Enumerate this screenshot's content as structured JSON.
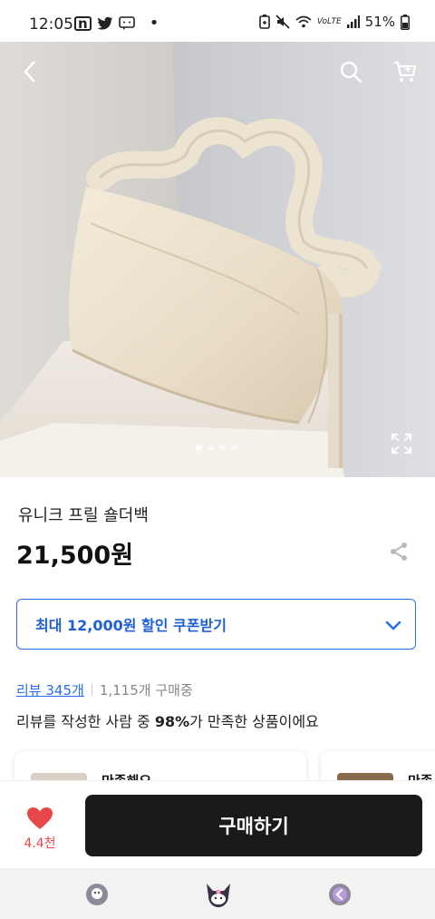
{
  "status_bar": {
    "time": "12:05",
    "battery": "51%",
    "left_icons": [
      "n-app-icon",
      "twitter-icon",
      "chat-icon",
      "dot-icon"
    ],
    "right_icons": [
      "battery-saver-icon",
      "mute-icon",
      "wifi-icon",
      "volte-icon",
      "signal-icon",
      "battery-icon"
    ],
    "volte_label": "VoLTE"
  },
  "hero": {
    "image_alt": "cream frill shoulder bag",
    "page_count": 4,
    "active_page": 1
  },
  "product": {
    "title": "유니크 프릴 숄더백",
    "price": "21,500원"
  },
  "coupon": {
    "label": "최대 12,000원 할인 쿠폰받기"
  },
  "reviews": {
    "link": "리뷰 345개",
    "purchases": "1,115개 구매중",
    "satisfaction_prefix": "리뷰를 작성한 사람 중 ",
    "satisfaction_percent": "98%",
    "satisfaction_suffix": "가 만족한 상품이에요"
  },
  "review_cards": [
    {
      "title": "만족해요"
    },
    {
      "title": "만족"
    }
  ],
  "bottom": {
    "like_count": "4.4천",
    "buy_label": "구매하기"
  },
  "colors": {
    "accent": "#2a6ef0",
    "like": "#e8474a",
    "buy_button": "#1a1a1a"
  }
}
